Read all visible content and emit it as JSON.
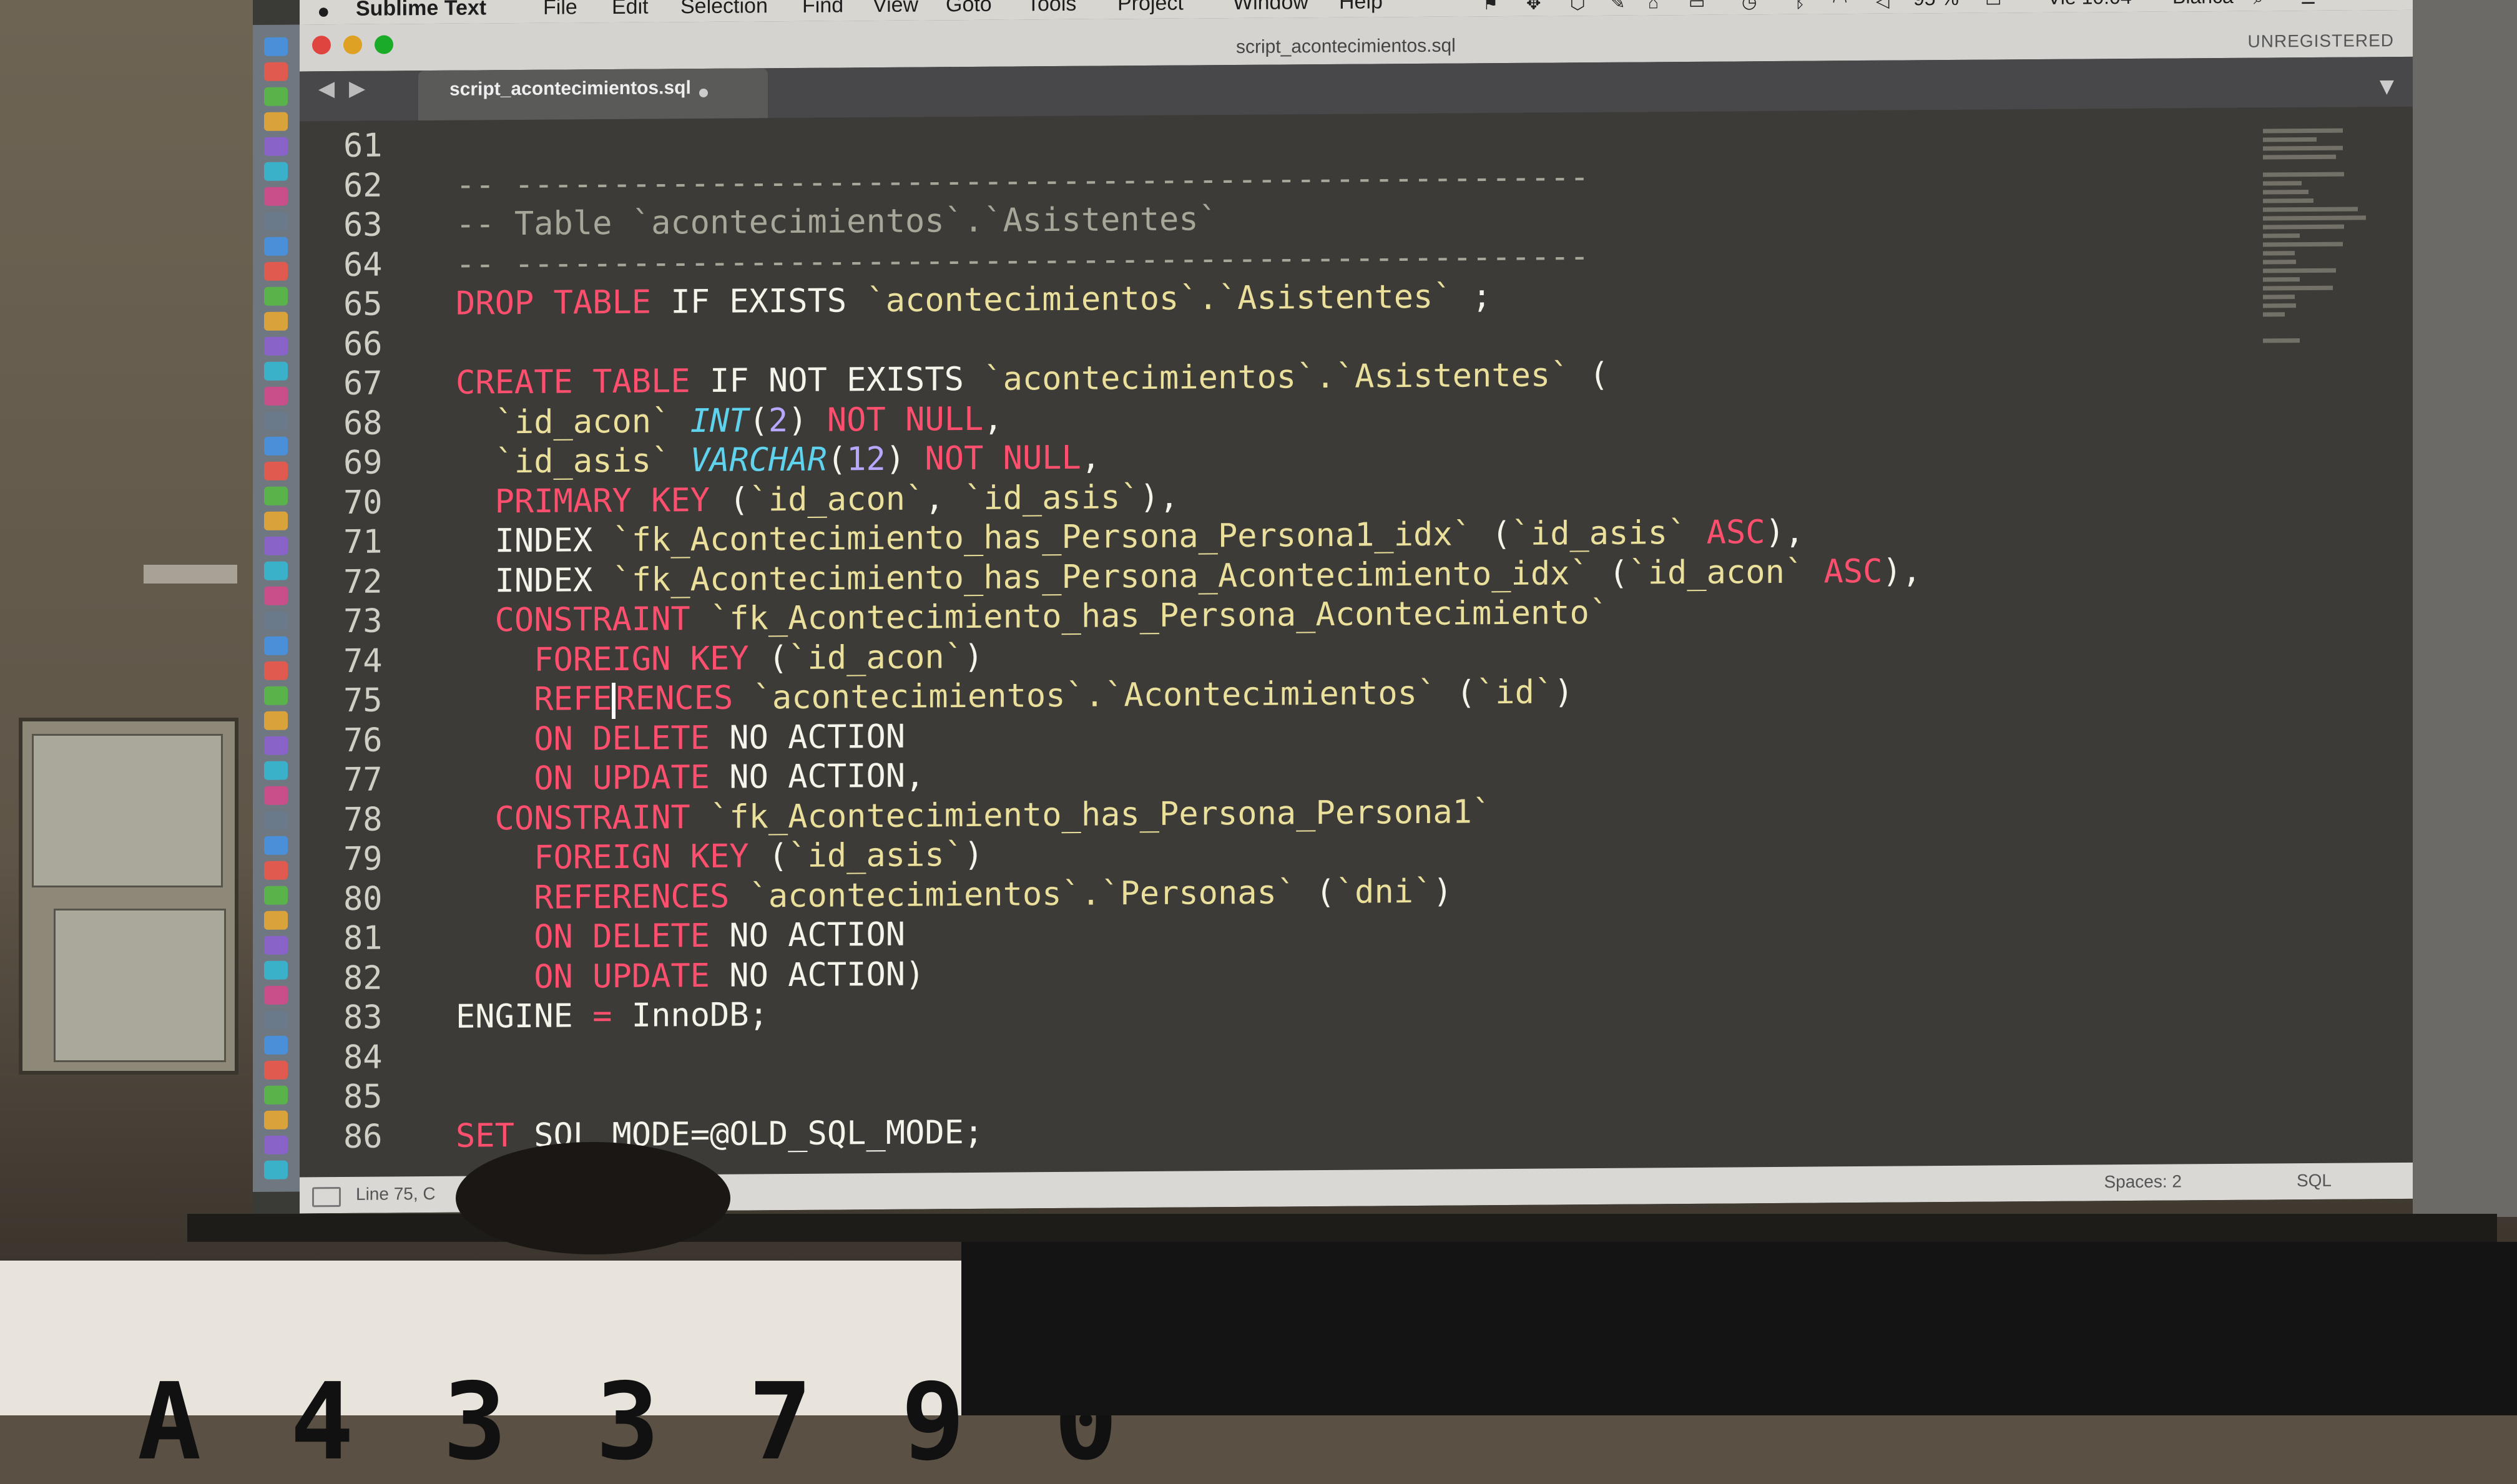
{
  "menubar": {
    "apple": "",
    "app_name": "Sublime Text",
    "items": [
      "File",
      "Edit",
      "Selection",
      "Find",
      "View",
      "Goto",
      "Tools",
      "Project",
      "Window",
      "Help"
    ],
    "battery": "95 %",
    "clock": "Vie 10:04",
    "user": "Blanca"
  },
  "titlebar": {
    "title": "script_acontecimientos.sql",
    "unregistered": "UNREGISTERED"
  },
  "tab": {
    "label": "script_acontecimientos.sql",
    "nav_arrows": "◀ ▶",
    "dropdown": "▼"
  },
  "editor": {
    "lines": [
      {
        "n": "61",
        "tokens": []
      },
      {
        "n": "62",
        "tokens": [
          {
            "t": "-- -------------------------------------------------------",
            "c": "comment"
          }
        ]
      },
      {
        "n": "63",
        "tokens": [
          {
            "t": "-- Table `acontecimientos`.`Asistentes`",
            "c": "comment"
          }
        ]
      },
      {
        "n": "64",
        "tokens": [
          {
            "t": "-- -------------------------------------------------------",
            "c": "comment"
          }
        ]
      },
      {
        "n": "65",
        "tokens": [
          {
            "t": "DROP TABLE",
            "c": "kw"
          },
          {
            "t": " IF EXISTS ",
            "c": "plain"
          },
          {
            "t": "`acontecimientos`.`Asistentes`",
            "c": "ident"
          },
          {
            "t": " ;",
            "c": "plain"
          }
        ]
      },
      {
        "n": "66",
        "tokens": []
      },
      {
        "n": "67",
        "tokens": [
          {
            "t": "CREATE TABLE",
            "c": "kw"
          },
          {
            "t": " IF NOT EXISTS ",
            "c": "plain"
          },
          {
            "t": "`acontecimientos`.`Asistentes`",
            "c": "ident"
          },
          {
            "t": " (",
            "c": "plain"
          }
        ]
      },
      {
        "n": "68",
        "tokens": [
          {
            "t": "  `id_acon` ",
            "c": "ident"
          },
          {
            "t": "INT",
            "c": "type"
          },
          {
            "t": "(",
            "c": "plain"
          },
          {
            "t": "2",
            "c": "num"
          },
          {
            "t": ") ",
            "c": "plain"
          },
          {
            "t": "NOT NULL",
            "c": "kw"
          },
          {
            "t": ",",
            "c": "plain"
          }
        ]
      },
      {
        "n": "69",
        "tokens": [
          {
            "t": "  `id_asis` ",
            "c": "ident"
          },
          {
            "t": "VARCHAR",
            "c": "type"
          },
          {
            "t": "(",
            "c": "plain"
          },
          {
            "t": "12",
            "c": "num"
          },
          {
            "t": ") ",
            "c": "plain"
          },
          {
            "t": "NOT NULL",
            "c": "kw"
          },
          {
            "t": ",",
            "c": "plain"
          }
        ]
      },
      {
        "n": "70",
        "tokens": [
          {
            "t": "  PRIMARY KEY",
            "c": "kw"
          },
          {
            "t": " (",
            "c": "plain"
          },
          {
            "t": "`id_acon`",
            "c": "ident"
          },
          {
            "t": ", ",
            "c": "plain"
          },
          {
            "t": "`id_asis`",
            "c": "ident"
          },
          {
            "t": "),",
            "c": "plain"
          }
        ]
      },
      {
        "n": "71",
        "tokens": [
          {
            "t": "  INDEX ",
            "c": "plain"
          },
          {
            "t": "`fk_Acontecimiento_has_Persona_Persona1_idx`",
            "c": "ident"
          },
          {
            "t": " (",
            "c": "plain"
          },
          {
            "t": "`id_asis` ",
            "c": "ident"
          },
          {
            "t": "ASC",
            "c": "kw"
          },
          {
            "t": "),",
            "c": "plain"
          }
        ]
      },
      {
        "n": "72",
        "tokens": [
          {
            "t": "  INDEX ",
            "c": "plain"
          },
          {
            "t": "`fk_Acontecimiento_has_Persona_Acontecimiento_idx`",
            "c": "ident"
          },
          {
            "t": " (",
            "c": "plain"
          },
          {
            "t": "`id_acon` ",
            "c": "ident"
          },
          {
            "t": "ASC",
            "c": "kw"
          },
          {
            "t": "),",
            "c": "plain"
          }
        ]
      },
      {
        "n": "73",
        "tokens": [
          {
            "t": "  CONSTRAINT ",
            "c": "kw"
          },
          {
            "t": "`fk_Acontecimiento_has_Persona_Acontecimiento`",
            "c": "ident"
          }
        ]
      },
      {
        "n": "74",
        "tokens": [
          {
            "t": "    FOREIGN KEY",
            "c": "kw"
          },
          {
            "t": " (",
            "c": "plain"
          },
          {
            "t": "`id_acon`",
            "c": "ident"
          },
          {
            "t": ")",
            "c": "plain"
          }
        ]
      },
      {
        "n": "75",
        "tokens": [
          {
            "t": "    REFE",
            "c": "kw"
          },
          {
            "t": "|",
            "c": "cursor"
          },
          {
            "t": "RENCES ",
            "c": "kw"
          },
          {
            "t": "`acontecimientos`.`Acontecimientos`",
            "c": "ident"
          },
          {
            "t": " (",
            "c": "plain"
          },
          {
            "t": "`id`",
            "c": "ident"
          },
          {
            "t": ")",
            "c": "plain"
          }
        ]
      },
      {
        "n": "76",
        "tokens": [
          {
            "t": "    ON DELETE ",
            "c": "kw"
          },
          {
            "t": "NO ACTION",
            "c": "plain"
          }
        ]
      },
      {
        "n": "77",
        "tokens": [
          {
            "t": "    ON UPDATE ",
            "c": "kw"
          },
          {
            "t": "NO ACTION,",
            "c": "plain"
          }
        ]
      },
      {
        "n": "78",
        "tokens": [
          {
            "t": "  CONSTRAINT ",
            "c": "kw"
          },
          {
            "t": "`fk_Acontecimiento_has_Persona_Persona1`",
            "c": "ident"
          }
        ]
      },
      {
        "n": "79",
        "tokens": [
          {
            "t": "    FOREIGN KEY",
            "c": "kw"
          },
          {
            "t": " (",
            "c": "plain"
          },
          {
            "t": "`id_asis`",
            "c": "ident"
          },
          {
            "t": ")",
            "c": "plain"
          }
        ]
      },
      {
        "n": "80",
        "tokens": [
          {
            "t": "    REFERENCES ",
            "c": "kw"
          },
          {
            "t": "`acontecimientos`.`Personas`",
            "c": "ident"
          },
          {
            "t": " (",
            "c": "plain"
          },
          {
            "t": "`dni`",
            "c": "ident"
          },
          {
            "t": ")",
            "c": "plain"
          }
        ]
      },
      {
        "n": "81",
        "tokens": [
          {
            "t": "    ON DELETE ",
            "c": "kw"
          },
          {
            "t": "NO ACTION",
            "c": "plain"
          }
        ]
      },
      {
        "n": "82",
        "tokens": [
          {
            "t": "    ON UPDATE ",
            "c": "kw"
          },
          {
            "t": "NO ACTION)",
            "c": "plain"
          }
        ]
      },
      {
        "n": "83",
        "tokens": [
          {
            "t": "ENGINE ",
            "c": "plain"
          },
          {
            "t": "=",
            "c": "kw"
          },
          {
            "t": " InnoDB;",
            "c": "plain"
          }
        ]
      },
      {
        "n": "84",
        "tokens": []
      },
      {
        "n": "85",
        "tokens": []
      },
      {
        "n": "86",
        "tokens": [
          {
            "t": "SET ",
            "c": "kw"
          },
          {
            "t": "SQL_MODE=@OLD_SQL_MODE;",
            "c": "plain"
          }
        ]
      }
    ]
  },
  "statusbar": {
    "position": "Line 75, C",
    "spaces": "Spaces: 2",
    "syntax": "SQL"
  },
  "colors": {
    "keyword": "#ff4f6e",
    "identifier": "#eadf9b",
    "type": "#5fd2ee",
    "number": "#b9a6ff",
    "comment": "#a8a698",
    "editor_bg": "#3c3b37"
  },
  "foreground": {
    "sign_text": "A 4 3 3 7 9 0"
  }
}
